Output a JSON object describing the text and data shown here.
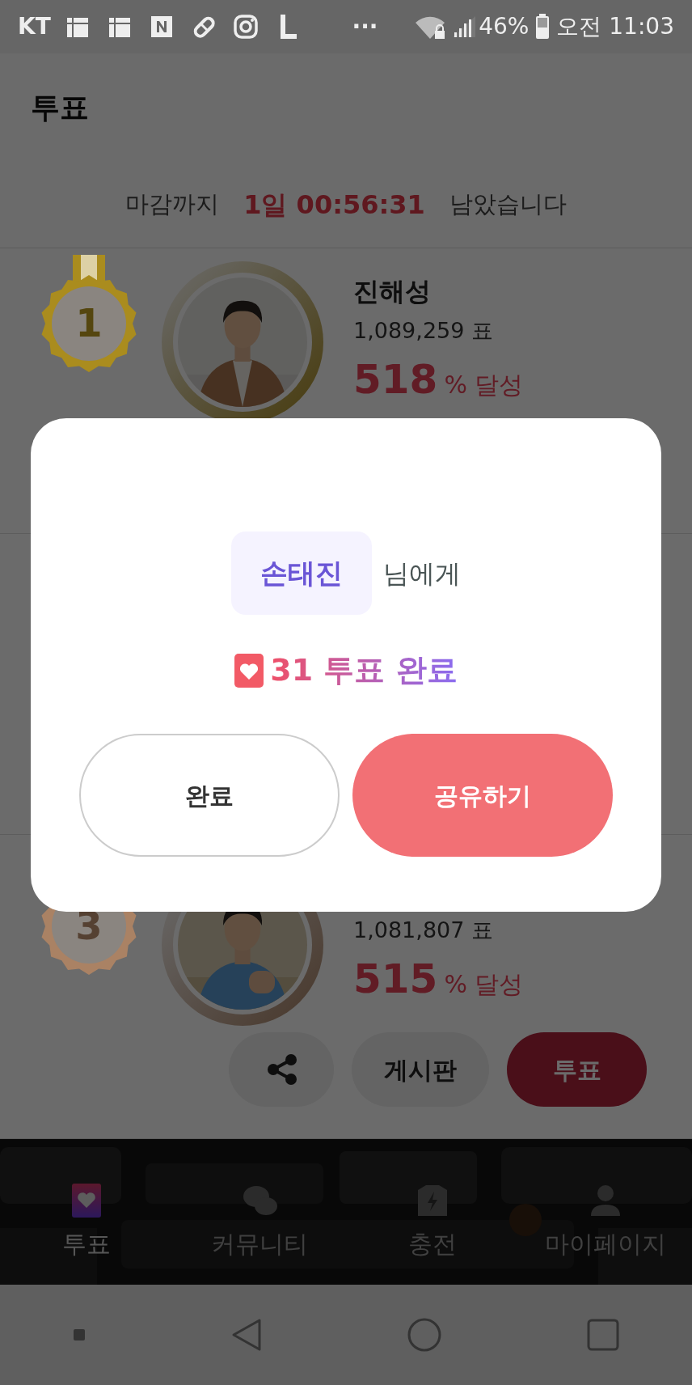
{
  "status_bar": {
    "carrier": "KT",
    "more": "···",
    "battery": "46%",
    "time": "오전 11:03"
  },
  "header": {
    "title": "투표"
  },
  "countdown": {
    "prefix": "마감까지",
    "remaining": "1일 00:56:31",
    "suffix": "남았습니다"
  },
  "ranking": [
    {
      "rank": "1",
      "color": "#aa8c1e",
      "name": "진해성",
      "votes": "1,089,259 표",
      "percent": "518",
      "percent_suffix": "% 달성"
    },
    {
      "rank": "3",
      "color": "#aa8264",
      "votes": "1,081,807 표",
      "percent": "515",
      "percent_suffix": "% 달성",
      "buttons": [
        {
          "label": "게시판",
          "kind": "board"
        },
        {
          "label": "투표",
          "kind": "vote"
        }
      ]
    }
  ],
  "modal": {
    "recipient": "손태진",
    "recipient_suffix": "님에게",
    "result": "31 투표 완료",
    "buttons": [
      {
        "label": "완료",
        "kind": "outline"
      },
      {
        "label": "공유하기",
        "kind": "primary"
      }
    ]
  },
  "bottom_nav": [
    {
      "label": "투표",
      "selected": true
    },
    {
      "label": "커뮤니티",
      "selected": false
    },
    {
      "label": "충전",
      "selected": false
    },
    {
      "label": "마이페이지",
      "selected": false
    }
  ]
}
